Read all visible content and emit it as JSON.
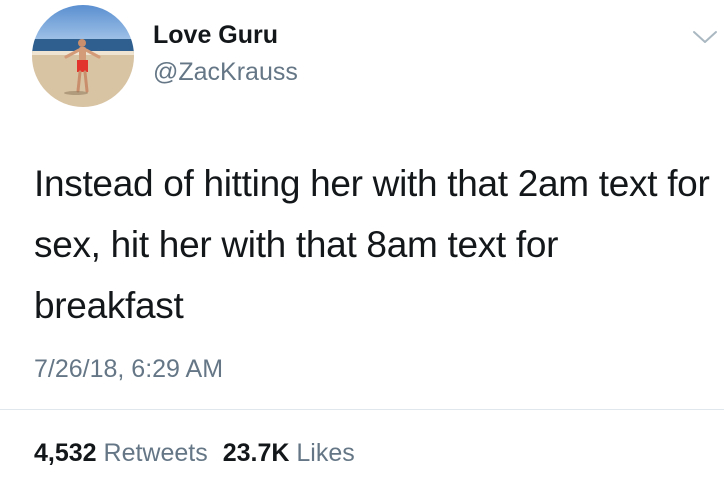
{
  "author": {
    "display_name": "Love Guru",
    "handle": "@ZacKrauss",
    "avatar_icon": "profile-photo-beach"
  },
  "tweet": {
    "text": "Instead of hitting her with that 2am text for sex, hit her with that 8am text for breakfast",
    "timestamp": "7/26/18, 6:29 AM"
  },
  "stats": {
    "retweets_count": "4,532",
    "retweets_label": "Retweets",
    "likes_count": "23.7K",
    "likes_label": "Likes"
  },
  "colors": {
    "text": "#14171a",
    "secondary": "#657786",
    "divider": "#e1e8ed"
  }
}
